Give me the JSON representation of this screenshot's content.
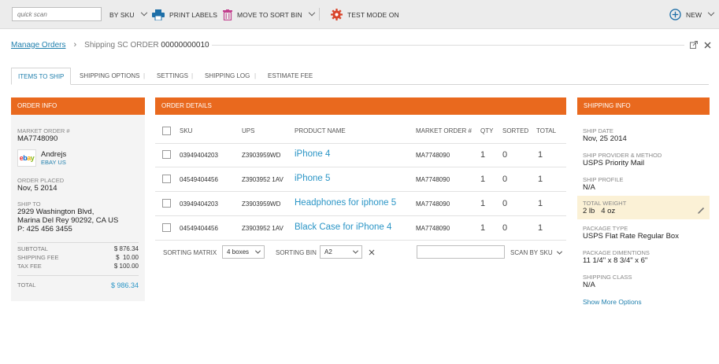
{
  "toolbar": {
    "search_placeholder": "quick scan",
    "by_sku": "BY SKU",
    "print_labels": "PRINT LABELS",
    "move_to_sort_bin": "MOVE TO SORT BIN",
    "test_mode": "TEST MODE ON",
    "new": "NEW"
  },
  "breadcrumb": {
    "root": "Manage Orders",
    "current_prefix": "Shipping SC ORDER",
    "current_number": "00000000010"
  },
  "tabs": [
    "ITEMS TO SHIP",
    "SHIPPING OPTIONS",
    "SETTINGS",
    "SHIPPING LOG",
    "ESTIMATE FEE"
  ],
  "order_info": {
    "title": "ORDER INFO",
    "market_order_label": "MARKET ORDER #",
    "market_order": "MA7748090",
    "customer_name": "Andrejs",
    "channel": "EBAY US",
    "order_placed_label": "ORDER PLACED",
    "order_placed": "Nov, 5 2014",
    "ship_to_label": "SHIP TO",
    "ship_to_line1": "2929 Washington Blvd,",
    "ship_to_line2": "Marina Del Rey 90292, CA US",
    "ship_to_phone": "P: 425 456 3455",
    "subtotal_label": "SUBTOTAL",
    "subtotal": "$ 876.34",
    "shipping_fee_label": "SHIPPING FEE",
    "shipping_fee": "$  10.00",
    "tax_fee_label": "TAX FEE",
    "tax_fee": "$ 100.00",
    "total_label": "TOTAL",
    "total": "$ 986.34"
  },
  "order_details": {
    "title": "ORDER DETAILS",
    "columns": [
      "SKU",
      "UPS",
      "PRODUCT NAME",
      "MARKET ORDER #",
      "QTY",
      "SORTED",
      "TOTAL"
    ],
    "rows": [
      {
        "sku": "03949404203",
        "ups": "Z3903959WD",
        "product": "iPhone 4",
        "market_order": "MA7748090",
        "qty": "1",
        "sorted": "0",
        "total": "1"
      },
      {
        "sku": "04549404456",
        "ups": "Z3903952 1AV",
        "product": "iPhone 5",
        "market_order": "MA7748090",
        "qty": "1",
        "sorted": "0",
        "total": "1"
      },
      {
        "sku": "03949404203",
        "ups": "Z3903959WD",
        "product": "Headphones for iphone 5",
        "market_order": "MA7748090",
        "qty": "1",
        "sorted": "0",
        "total": "1"
      },
      {
        "sku": "04549404456",
        "ups": "Z3903952 1AV",
        "product": "Black Case for iPhone 4",
        "market_order": "MA7748090",
        "qty": "1",
        "sorted": "0",
        "total": "1"
      }
    ],
    "sorting_matrix_label": "SORTING MATRIX",
    "sorting_matrix_value": "4 boxes",
    "sorting_bin_label": "SORTING BIN",
    "sorting_bin_value": "A2",
    "scan_by": "SCAN BY SKU"
  },
  "shipping_info": {
    "title": "SHIPPING INFO",
    "ship_date_label": "SHIP DATE",
    "ship_date": "Nov, 25 2014",
    "provider_label": "SHIP PROVIDER & METHOD",
    "provider": "USPS Priority Mail",
    "profile_label": "SHIP PROFILE",
    "profile": "N/A",
    "weight_label": "TOTAL WEIGHT",
    "weight": "2 lb   4 oz",
    "package_type_label": "PACKAGE TYPE",
    "package_type": "USPS Flat Rate Regular Box",
    "package_dim_label": "PACKAGE DIMENTIONS",
    "package_dim": "11 1/4\" x 8 3/4\" x 6\"",
    "shipping_class_label": "SHIPPING CLASS",
    "shipping_class": "N/A",
    "more_options": "Show More Options"
  },
  "colors": {
    "accent_orange": "#e9691e",
    "link_blue": "#1f7fad",
    "product_blue": "#2a95c6",
    "weight_highlight": "#fbf1d6",
    "test_mode_red": "#d9452b",
    "print_blue": "#1e6fa8",
    "sort_bin_pink": "#c2418f"
  }
}
